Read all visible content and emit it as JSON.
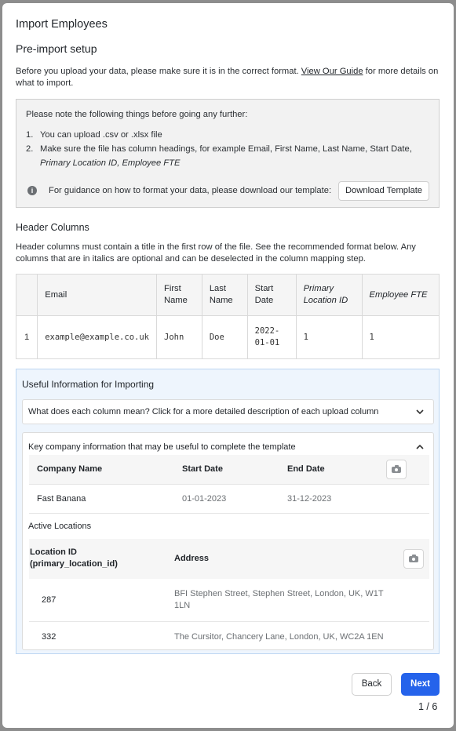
{
  "modal": {
    "title": "Import Employees",
    "section_title": "Pre-import setup",
    "intro_before": "Before you upload your data, please make sure it is in the correct format. ",
    "intro_link": "View Our Guide",
    "intro_after": " for more details on what to import."
  },
  "notice": {
    "heading": "Please note the following things before going any further:",
    "items": [
      {
        "num": "1.",
        "text": "You can upload .csv or .xlsx file"
      },
      {
        "num": "2.",
        "text": "Make sure the file has column headings, for example Email, First Name, Last Name, Start Date,",
        "italic": "Primary Location ID, Employee FTE"
      }
    ],
    "guidance_text": "For guidance on how to format your data, please download our template:",
    "info_icon": "info-icon",
    "download_label": "Download Template"
  },
  "header_columns": {
    "title": "Header Columns",
    "description": "Header columns must contain a title in the first row of the file. See the recommended format below. Any columns that are in italics are optional and can be deselected in the column mapping step.",
    "table": {
      "headers": [
        "",
        "Email",
        "First Name",
        "Last Name",
        "Start Date",
        "Primary Location ID",
        "Employee FTE"
      ],
      "row": [
        "1",
        "example@example.co.uk",
        "John",
        "Doe",
        "2022-01-01",
        "1",
        "1"
      ]
    }
  },
  "useful": {
    "title": "Useful Information for Importing",
    "accordion1_label": "What does each column mean? Click for a more detailed description of each upload column",
    "accordion2_label": "Key company information that may be useful to complete the template",
    "company_table": {
      "headers": [
        "Company Name",
        "Start Date",
        "End Date"
      ],
      "row": [
        "Fast Banana",
        "01-01-2023",
        "31-12-2023"
      ]
    },
    "active_locations_title": "Active Locations",
    "locations_table": {
      "headers": [
        "Location ID (primary_location_id)",
        "Address"
      ],
      "rows": [
        {
          "id": "287",
          "address": "BFI Stephen Street, Stephen Street, London, UK, W1T 1LN"
        },
        {
          "id": "332",
          "address": "The Cursitor, Chancery Lane, London, UK, WC2A 1EN"
        }
      ]
    }
  },
  "footer": {
    "back_label": "Back",
    "next_label": "Next",
    "page_indicator": "1 / 6",
    "next_color": "#2563eb"
  }
}
